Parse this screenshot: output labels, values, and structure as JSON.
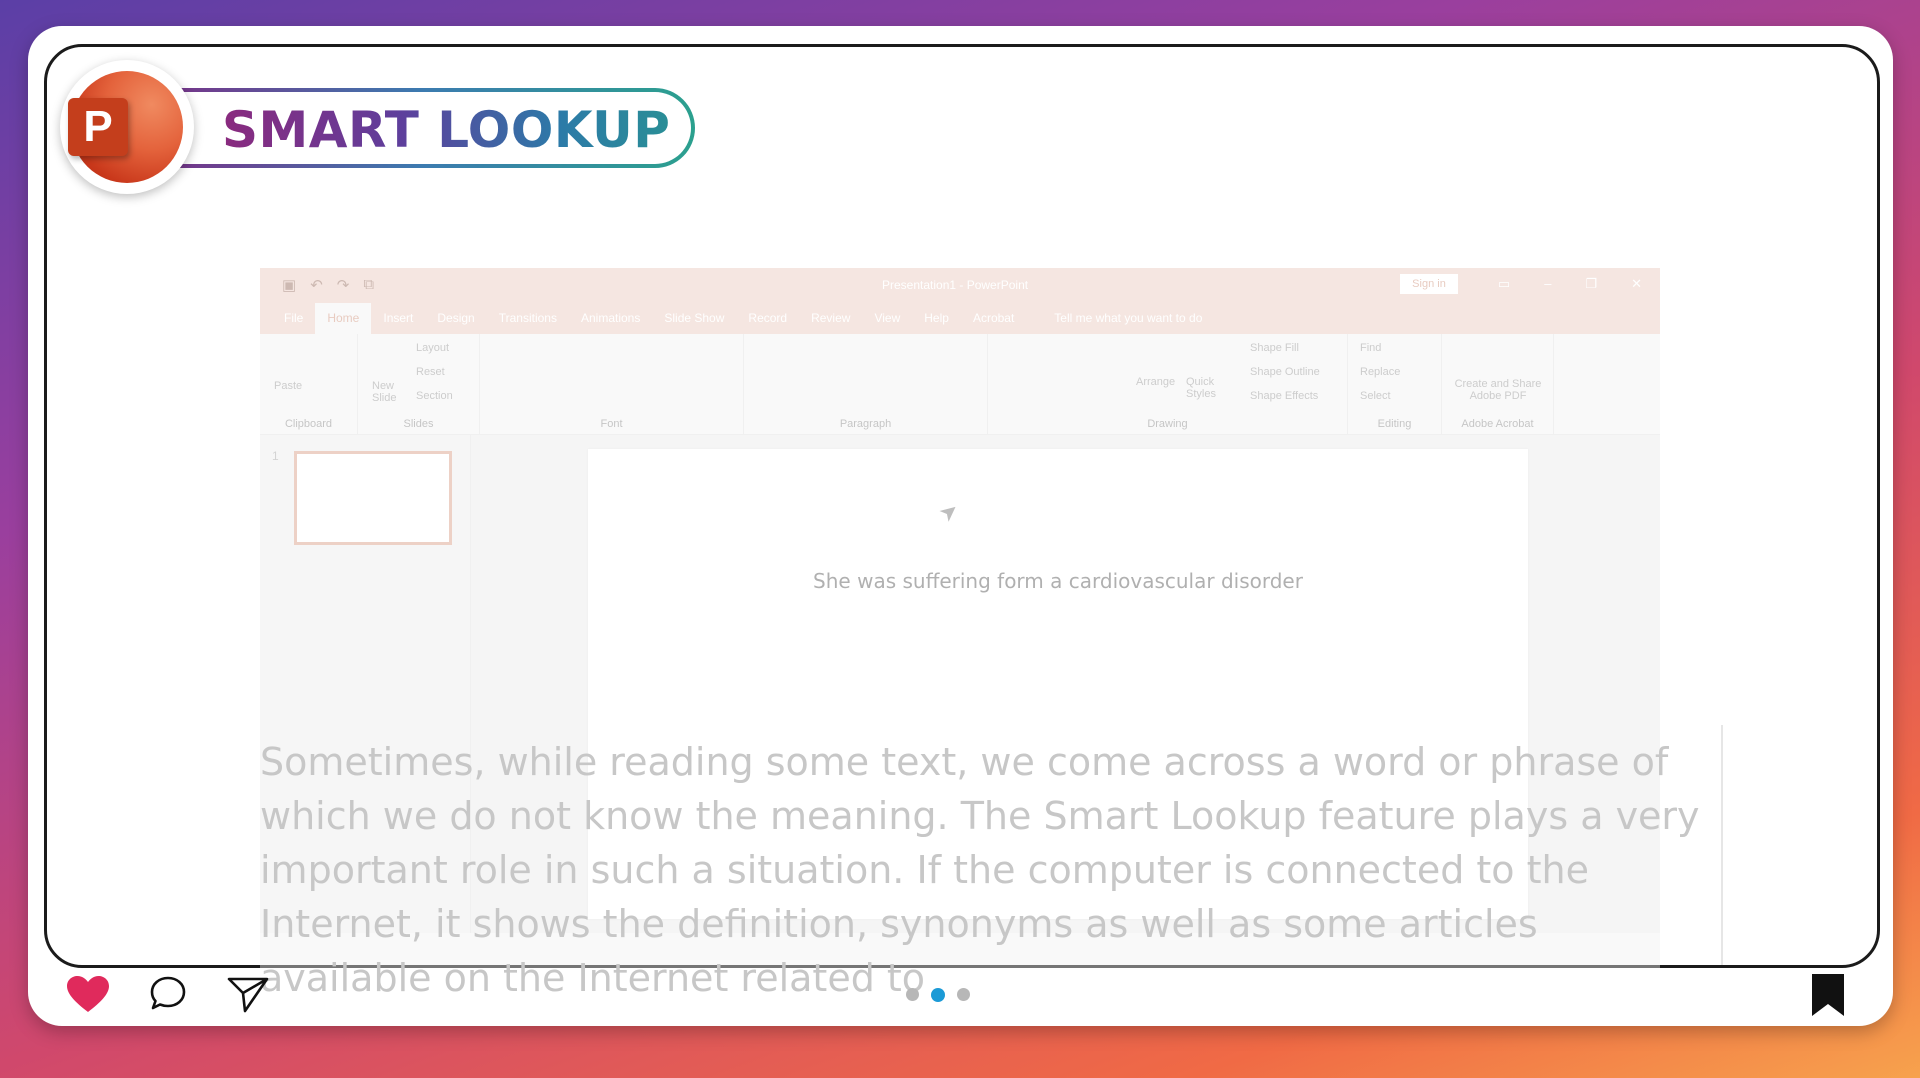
{
  "header": {
    "title": "SMART LOOKUP",
    "logo_letter": "P",
    "logo_icon": "powerpoint-logo-icon"
  },
  "powerpoint": {
    "window_title": "Presentation1 - PowerPoint",
    "sign_in_label": "Sign in",
    "tabs": [
      "File",
      "Home",
      "Insert",
      "Design",
      "Transitions",
      "Animations",
      "Slide Show",
      "Record",
      "Review",
      "View",
      "Help",
      "Acrobat"
    ],
    "active_tab": "Home",
    "tell_me": "Tell me what you want to do",
    "ribbon": {
      "clipboard": {
        "label": "Clipboard",
        "paste": "Paste"
      },
      "slides": {
        "label": "Slides",
        "new_slide_1": "New",
        "new_slide_2": "Slide",
        "layout": "Layout",
        "reset": "Reset",
        "section": "Section"
      },
      "font": {
        "label": "Font"
      },
      "paragraph": {
        "label": "Paragraph"
      },
      "drawing": {
        "label": "Drawing",
        "arrange": "Arrange",
        "quick_styles_1": "Quick",
        "quick_styles_2": "Styles",
        "shape_fill": "Shape Fill",
        "shape_outline": "Shape Outline",
        "shape_effects": "Shape Effects"
      },
      "editing": {
        "label": "Editing",
        "find": "Find",
        "replace": "Replace",
        "select": "Select"
      },
      "acrobat": {
        "label": "Adobe Acrobat",
        "create_1": "Create and Share",
        "create_2": "Adobe PDF"
      }
    },
    "slide_number": "1",
    "slide_text": "She was suffering form a cardiovascular disorder"
  },
  "description": "Sometimes, while reading some text, we come across a word or phrase of which we do not know the meaning. The Smart Lookup feature plays a very important role in such a situation. If the computer is connected to the Internet, it shows the definition, synonyms as well as some articles available on the Internet related to",
  "footer": {
    "icons": [
      "heart-icon",
      "comment-icon",
      "send-icon",
      "bookmark-icon"
    ],
    "pagination": {
      "count": 3,
      "active_index": 1
    },
    "colors": {
      "heart": "#e02a5c",
      "active_dot": "#1b9ad6",
      "inactive_dot": "#b7b7b7"
    }
  }
}
